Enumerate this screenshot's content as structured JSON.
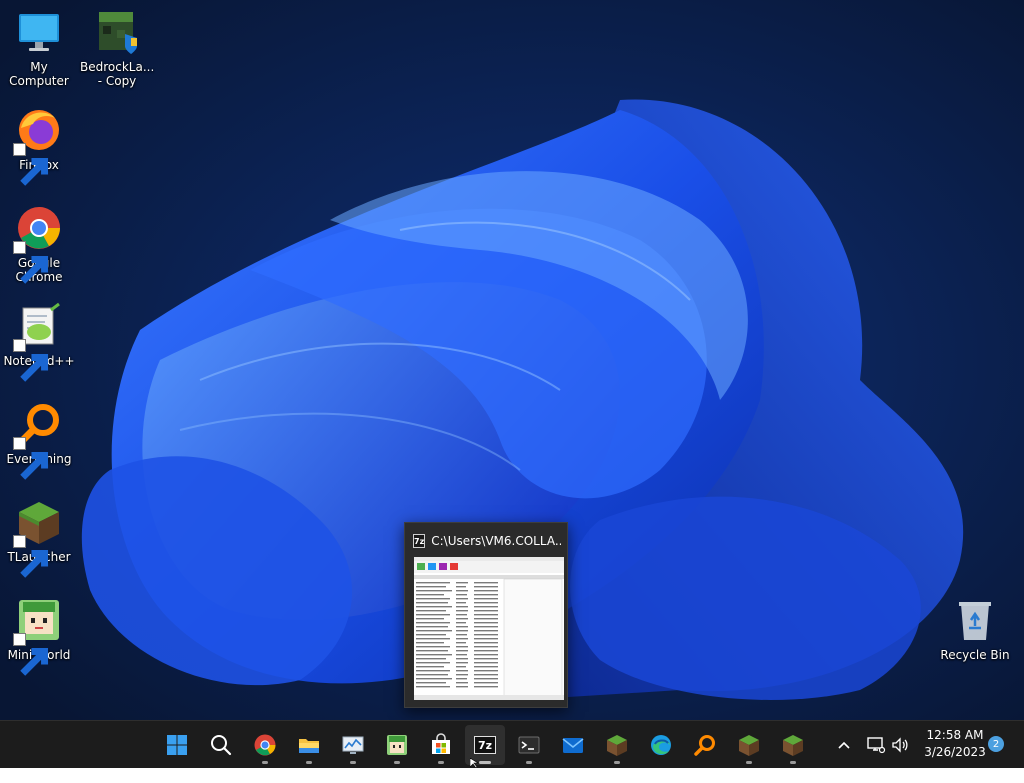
{
  "desktop": {
    "icons": [
      {
        "label": "My Computer"
      },
      {
        "label": "BedrockLa... - Copy"
      },
      {
        "label": "Firefox"
      },
      {
        "label": "Google Chrome"
      },
      {
        "label": "Notepad++"
      },
      {
        "label": "Everything"
      },
      {
        "label": "TLauncher"
      },
      {
        "label": "Mini World"
      },
      {
        "label": "Recycle Bin"
      }
    ]
  },
  "preview": {
    "title": "C:\\Users\\VM6.COLLA...",
    "app_icon_text": "7z"
  },
  "taskbar": {
    "items": [
      {
        "name": "Start",
        "icon": "windows-start-icon"
      },
      {
        "name": "Search",
        "icon": "search-icon"
      },
      {
        "name": "Google Chrome",
        "icon": "chrome-icon"
      },
      {
        "name": "File Explorer",
        "icon": "folder-icon"
      },
      {
        "name": "Resource Monitor",
        "icon": "monitor-chart-icon"
      },
      {
        "name": "Mini World",
        "icon": "mini-world-icon"
      },
      {
        "name": "Microsoft Store",
        "icon": "store-icon"
      },
      {
        "name": "7-Zip",
        "icon": "7zip-icon",
        "text": "7z"
      },
      {
        "name": "Terminal",
        "icon": "terminal-icon"
      },
      {
        "name": "Mail",
        "icon": "mail-icon"
      },
      {
        "name": "Minecraft",
        "icon": "grass-block-icon"
      },
      {
        "name": "Microsoft Edge",
        "icon": "edge-icon"
      },
      {
        "name": "Everything",
        "icon": "magnifier-icon"
      },
      {
        "name": "Minecraft 2",
        "icon": "grass-block-icon"
      },
      {
        "name": "Minecraft 3",
        "icon": "grass-block-icon"
      }
    ],
    "clock": {
      "time": "12:58 AM",
      "date": "3/26/2023"
    },
    "notification_count": "2"
  },
  "colors": {
    "taskbar_bg": "#1c1c1c",
    "accent": "#0078d4",
    "wallpaper_bloom": "#1f4fe0"
  }
}
